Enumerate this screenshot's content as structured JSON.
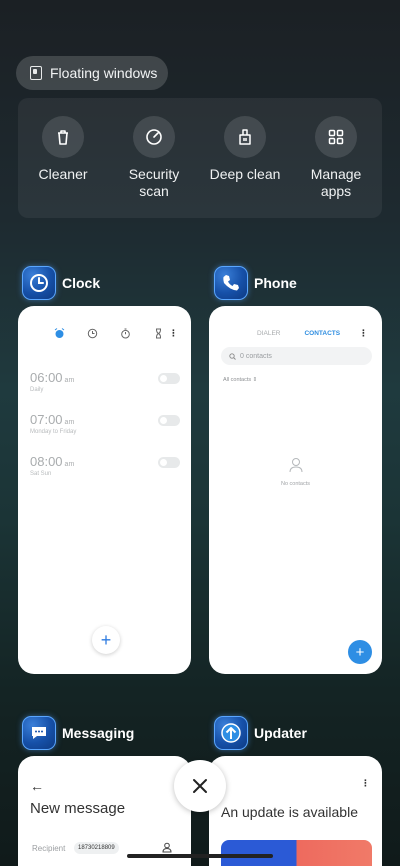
{
  "floating": {
    "label": "Floating windows"
  },
  "tools": [
    {
      "label": "Cleaner",
      "icon": "trash-icon"
    },
    {
      "label": "Security scan",
      "icon": "security-icon"
    },
    {
      "label": "Deep clean",
      "icon": "broom-icon"
    },
    {
      "label": "Manage apps",
      "icon": "grid-icon"
    }
  ],
  "apps": {
    "clock": {
      "name": "Clock",
      "alarms": [
        {
          "time": "06:00",
          "ampm": "am",
          "sub": "Daily"
        },
        {
          "time": "07:00",
          "ampm": "am",
          "sub": "Monday to Friday"
        },
        {
          "time": "08:00",
          "ampm": "am",
          "sub": "Sat Sun"
        }
      ],
      "fab": "+"
    },
    "phone": {
      "name": "Phone",
      "tab_dialer": "DIALER",
      "tab_contacts": "CONTACTS",
      "search_placeholder": "0 contacts",
      "filter": "All contacts",
      "empty": "No contacts",
      "fab": "+"
    },
    "messaging": {
      "name": "Messaging",
      "back": "←",
      "title": "New message",
      "recipient_label": "Recipient",
      "recipient_value": "18730218809"
    },
    "updater": {
      "name": "Updater",
      "title": "An update is available"
    }
  },
  "colors": {
    "accent": "#2e8ee4",
    "icon_bg": "#1650a8"
  }
}
